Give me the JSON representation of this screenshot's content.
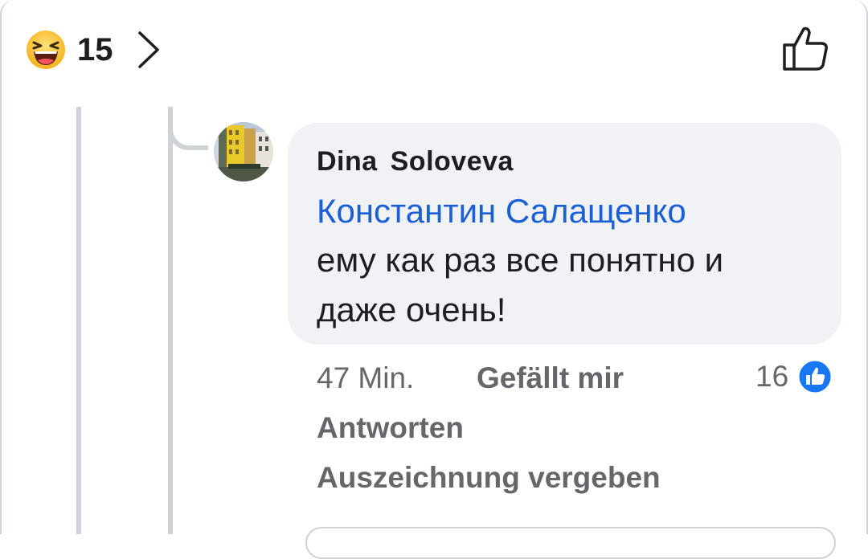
{
  "header": {
    "reaction_count": "15",
    "reaction_icon": "laughing-emoji-icon",
    "like_icon": "thumbs-up-outline-icon"
  },
  "comment": {
    "author": "Dina  Soloveva",
    "mention": "Константин Салащенко",
    "text_line1": "ему как раз все понятно и",
    "text_line2": "даже очень!",
    "timestamp": "47 Min.",
    "like_label": "Gefällt mir",
    "reply_label": "Antworten",
    "award_label": "Auszeichnung vergeben",
    "like_count": "16",
    "like_badge_color": "#1877f2",
    "mention_color": "#1a5fd6"
  }
}
